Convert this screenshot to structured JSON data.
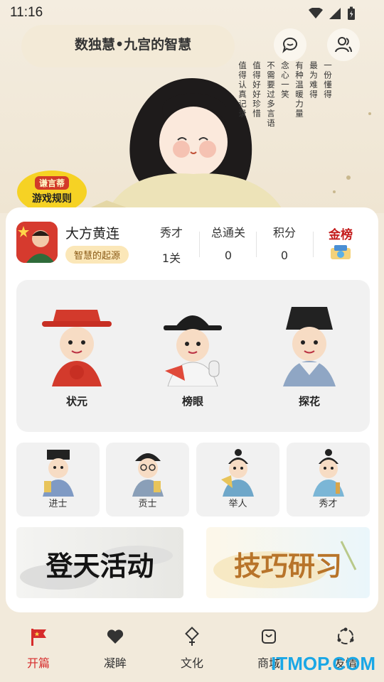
{
  "status": {
    "time": "11:16"
  },
  "header": {
    "title": "数独慧•九宫的智慧",
    "chat_icon": "chat-bubble-icon",
    "friends_icon": "friends-icon"
  },
  "poem_columns": [
    "一份懂得",
    "最为难得",
    "有种温暖力量",
    "念心一笑",
    "不需要过多言语",
    "值得好好珍惜",
    "值得认真记录"
  ],
  "rules_bubble": {
    "tag": "谦言蒂",
    "label": "游戏规则"
  },
  "user": {
    "name": "大方黄连",
    "badge": "智慧的起源"
  },
  "stats": [
    {
      "label": "秀才",
      "value": "1关"
    },
    {
      "label": "总通关",
      "value": "0"
    },
    {
      "label": "积分",
      "value": "0"
    }
  ],
  "gold_board": {
    "label": "金榜"
  },
  "top3": [
    {
      "label": "状元"
    },
    {
      "label": "榜眼"
    },
    {
      "label": "探花"
    }
  ],
  "ranks": [
    {
      "label": "进士"
    },
    {
      "label": "贡士"
    },
    {
      "label": "举人"
    },
    {
      "label": "秀才"
    }
  ],
  "banners": [
    {
      "text": "登天活动"
    },
    {
      "text": "技巧研习"
    }
  ],
  "nav": [
    {
      "label": "开篇",
      "icon": "flag-icon",
      "active": true
    },
    {
      "label": "凝眸",
      "icon": "heart-icon",
      "active": false
    },
    {
      "label": "文化",
      "icon": "knot-icon",
      "active": false
    },
    {
      "label": "商城",
      "icon": "shop-bag-icon",
      "active": false
    },
    {
      "label": "友情",
      "icon": "friends-circle-icon",
      "active": false
    }
  ],
  "watermark": "ITMOP.COM",
  "colors": {
    "accent": "#d62b2b",
    "badge_bg": "#fbe7b8",
    "rules_yellow": "#f6d224"
  }
}
